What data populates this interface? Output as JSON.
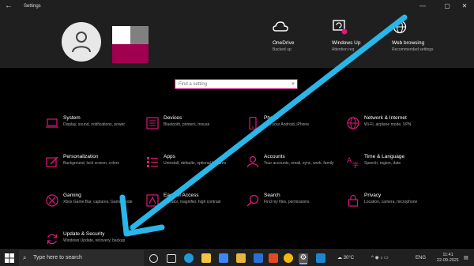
{
  "window": {
    "title": "Settings",
    "back_icon": "back-arrow-icon",
    "controls": [
      "minimize-icon",
      "maximize-icon",
      "close-icon"
    ]
  },
  "header_tiles": [
    {
      "name": "OneDrive",
      "sub": "Backed up",
      "icon": "cloud-icon"
    },
    {
      "name": "Windows Up",
      "sub": "Attention req",
      "icon": "windows-update-icon"
    },
    {
      "name": "Web browsing",
      "sub": "Recommended settings",
      "icon": "globe-icon"
    }
  ],
  "search": {
    "placeholder": "Find a setting",
    "icon": "search-icon"
  },
  "categories": [
    {
      "title": "System",
      "sub": "Display, sound, notifications, power",
      "icon": "laptop-icon"
    },
    {
      "title": "Devices",
      "sub": "Bluetooth, printers, mouse",
      "icon": "keyboard-icon"
    },
    {
      "title": "Phone",
      "sub": "Link your Android, iPhone",
      "icon": "phone-icon"
    },
    {
      "title": "Network & Internet",
      "sub": "Wi-Fi, airplane mode, VPN",
      "icon": "globe-icon"
    },
    {
      "title": "Personalization",
      "sub": "Background, lock screen, colors",
      "icon": "paint-icon"
    },
    {
      "title": "Apps",
      "sub": "Uninstall, defaults, optional features",
      "icon": "apps-list-icon"
    },
    {
      "title": "Accounts",
      "sub": "Your accounts, email, sync, work, family",
      "icon": "person-icon"
    },
    {
      "title": "Time & Language",
      "sub": "Speech, region, date",
      "icon": "time-language-icon"
    },
    {
      "title": "Gaming",
      "sub": "Xbox Game Bar, captures, Game Mode",
      "icon": "xbox-icon"
    },
    {
      "title": "Ease of Access",
      "sub": "Narrator, magnifier, high contrast",
      "icon": "ease-of-access-icon"
    },
    {
      "title": "Search",
      "sub": "Find my files, permissions",
      "icon": "search-icon"
    },
    {
      "title": "Privacy",
      "sub": "Location, camera, microphone",
      "icon": "lock-icon"
    },
    {
      "title": "Update & Security",
      "sub": "Windows Update, recovery, backup",
      "icon": "refresh-icon"
    }
  ],
  "taskbar": {
    "search_placeholder": "Type here to search",
    "apps": [
      "task-view-icon",
      "cortana-icon",
      "edge-icon",
      "file-explorer-icon",
      "dropbox-icon",
      "file-explorer-icon",
      "mail-icon",
      "office-icon",
      "chrome-icon",
      "settings-icon",
      "vscode-icon",
      "app-icon"
    ],
    "weather": "30°C",
    "language": "ENG",
    "time": "11:41",
    "date": "22-09-2021"
  },
  "colors": {
    "accent": "#e0177a",
    "annotation_arrow": "#29b6e8",
    "background": "#000000",
    "header": "#1f1f1f"
  }
}
